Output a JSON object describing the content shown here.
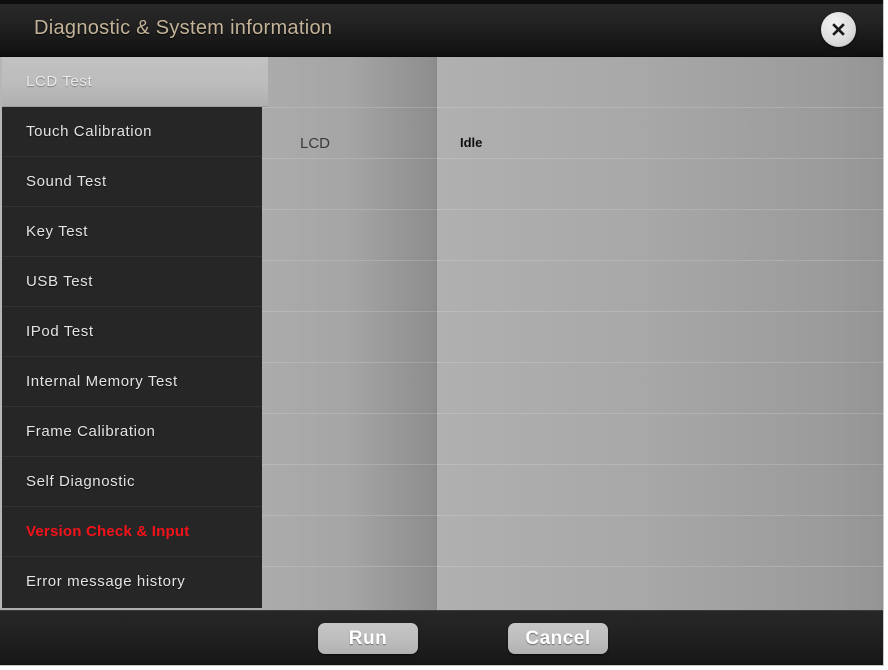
{
  "window": {
    "title": "Diagnostic & System information",
    "close_icon": "close-x-icon",
    "title_color": "#c3b398",
    "background_color": "#1d1d1d"
  },
  "sidebar": {
    "items": [
      {
        "label": "LCD Test",
        "state": "selected"
      },
      {
        "label": "Touch Calibration",
        "state": "normal"
      },
      {
        "label": "Sound Test",
        "state": "normal"
      },
      {
        "label": "Key Test",
        "state": "normal"
      },
      {
        "label": "USB Test",
        "state": "normal"
      },
      {
        "label": "IPod Test",
        "state": "normal"
      },
      {
        "label": "Internal Memory Test",
        "state": "normal"
      },
      {
        "label": "Frame Calibration",
        "state": "normal"
      },
      {
        "label": "Self Diagnostic",
        "state": "normal"
      },
      {
        "label": "Version Check & Input",
        "state": "alert"
      },
      {
        "label": "Error message history",
        "state": "normal"
      }
    ],
    "alert_color": "#f3121a",
    "selected_background": "#bcbcbc"
  },
  "content": {
    "rows": [
      {
        "name": "LCD",
        "status": "Idle"
      }
    ],
    "background_color": "#aaaaaa"
  },
  "footer": {
    "run_label": "Run",
    "cancel_label": "Cancel"
  }
}
